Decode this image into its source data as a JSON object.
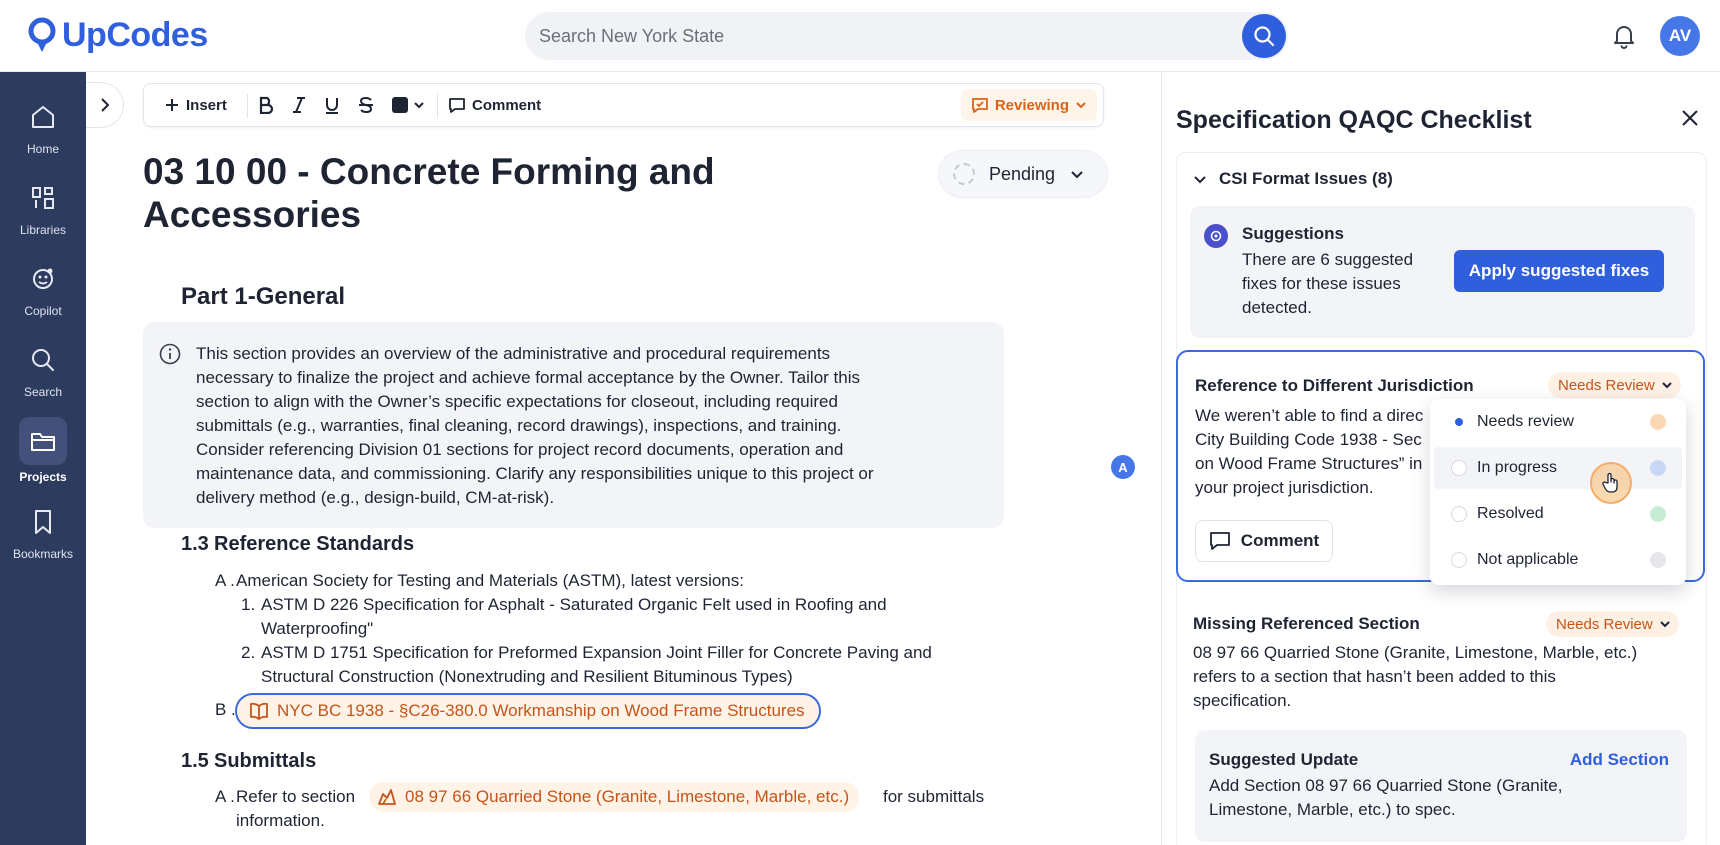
{
  "header": {
    "logo_text": "UpCodes",
    "search_placeholder": "Search New York State",
    "avatar_initials": "AV"
  },
  "sidebar": {
    "items": [
      {
        "label": "Home",
        "icon": "home-icon"
      },
      {
        "label": "Libraries",
        "icon": "libraries-icon"
      },
      {
        "label": "Copilot",
        "icon": "copilot-icon"
      },
      {
        "label": "Search",
        "icon": "search-icon"
      },
      {
        "label": "Projects",
        "icon": "folder-icon",
        "active": true
      },
      {
        "label": "Bookmarks",
        "icon": "bookmark-icon"
      }
    ]
  },
  "toolbar": {
    "insert_label": "Insert",
    "comment_label": "Comment",
    "reviewing_label": "Reviewing"
  },
  "document": {
    "title": "03 10 00 - Concrete Forming and Accessories",
    "status": "Pending",
    "part_heading": "Part 1-General",
    "info_text": "This section provides an overview of the administrative and procedural requirements necessary to finalize the project and achieve formal acceptance by the Owner. Tailor this section to align with the Owner’s specific expectations for closeout, including required submittals (e.g., warranties, final cleaning, record drawings), inspections, and training. Consider referencing Division 01 sections for project record documents, operation and maintenance data, and commissioning. Clarify any responsibilities unique to this project or delivery method (e.g., design-build, CM-at-risk).",
    "sections": [
      {
        "number": "1.3",
        "title": "Reference Standards",
        "item_a_marker": "A .",
        "item_a": "American Society for Testing and Materials (ASTM), latest versions:",
        "sub_items": [
          {
            "marker": "1.",
            "line1": "ASTM D 226 Specification for Asphalt - Saturated Organic Felt used in Roofing and",
            "line2": "Waterproofing\""
          },
          {
            "marker": "2.",
            "line1": "ASTM D 1751 Specification for Preformed Expansion Joint Filler for Concrete Paving and",
            "line2": "Structural Construction (Nonextruding and Resilient Bituminous Types)"
          }
        ],
        "item_b_marker": "B .",
        "item_b_ref": "NYC BC 1938 - §C26-380.0 Workmanship on Wood Frame Structures"
      },
      {
        "number": "1.5",
        "title": "Submittals",
        "item_a_marker": "A .",
        "item_a_prefix": "Refer to section",
        "item_a_ref": "08 97 66 Quarried Stone (Granite, Limestone, Marble, etc.)",
        "item_a_suffix": "for submittals",
        "item_a_line2": "information."
      }
    ],
    "collaborator_initial": "A"
  },
  "panel": {
    "title": "Specification QAQC Checklist",
    "group_label": "CSI Format Issues (8)",
    "suggestions": {
      "title": "Suggestions",
      "body": "There are 6 suggested fixes for these issues detected.",
      "apply_label": "Apply suggested fixes"
    },
    "issue1": {
      "title": "Reference to Different Jurisdiction",
      "status": "Needs Review",
      "body_lines": [
        "We weren’t able to find a direc",
        "City Building Code 1938 - Sec",
        "on Wood Frame Structures” in",
        "your project jurisdiction."
      ],
      "comment_label": "Comment"
    },
    "status_menu": [
      {
        "label": "Needs review",
        "color": "#fbd7b2",
        "selected": true
      },
      {
        "label": "In progress",
        "color": "#c9d8f7",
        "hover": true
      },
      {
        "label": "Resolved",
        "color": "#c6ecd2"
      },
      {
        "label": "Not applicable",
        "color": "#e4e6ec"
      }
    ],
    "issue2": {
      "title": "Missing Referenced Section",
      "status": "Needs Review",
      "body": "08 97 66 Quarried Stone (Granite, Limestone, Marble, etc.) refers to a section that hasn’t been added to this specification."
    },
    "suggested_update": {
      "title": "Suggested Update",
      "action": "Add Section",
      "body": "Add Section 08 97 66 Quarried Stone (Granite, Limestone, Marble, etc.) to spec."
    }
  }
}
